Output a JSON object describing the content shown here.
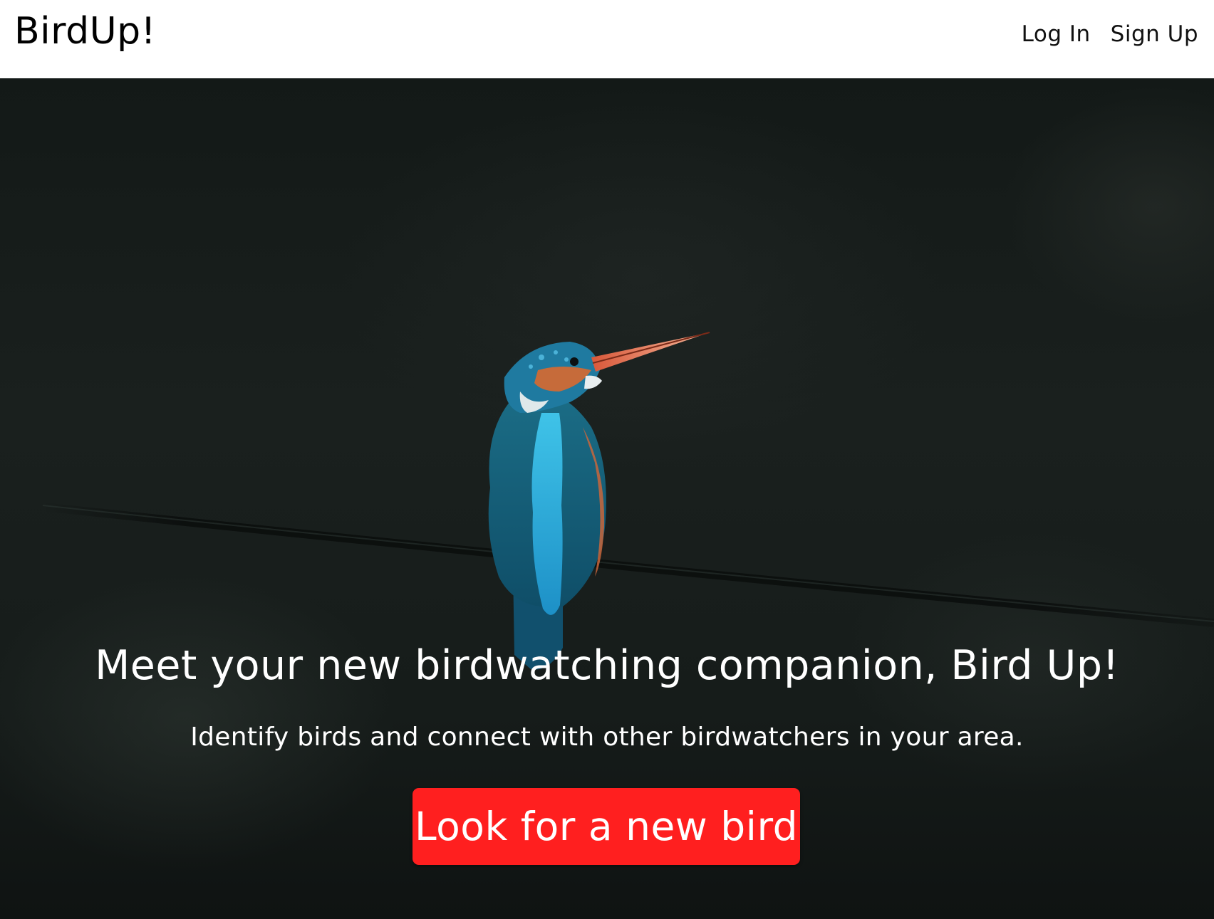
{
  "navbar": {
    "brand": "BirdUp!",
    "links": [
      {
        "label": "Log In"
      },
      {
        "label": "Sign Up"
      }
    ]
  },
  "hero": {
    "image_subject": "kingfisher perched on wire",
    "title": "Meet your new birdwatching companion, Bird Up!",
    "subtitle": "Identify birds and connect with other birdwatchers in your area.",
    "cta_label": "Look for a new bird"
  },
  "colors": {
    "cta_background": "#ff1f1f",
    "hero_background": "#161c1a",
    "navbar_background": "#ffffff"
  }
}
